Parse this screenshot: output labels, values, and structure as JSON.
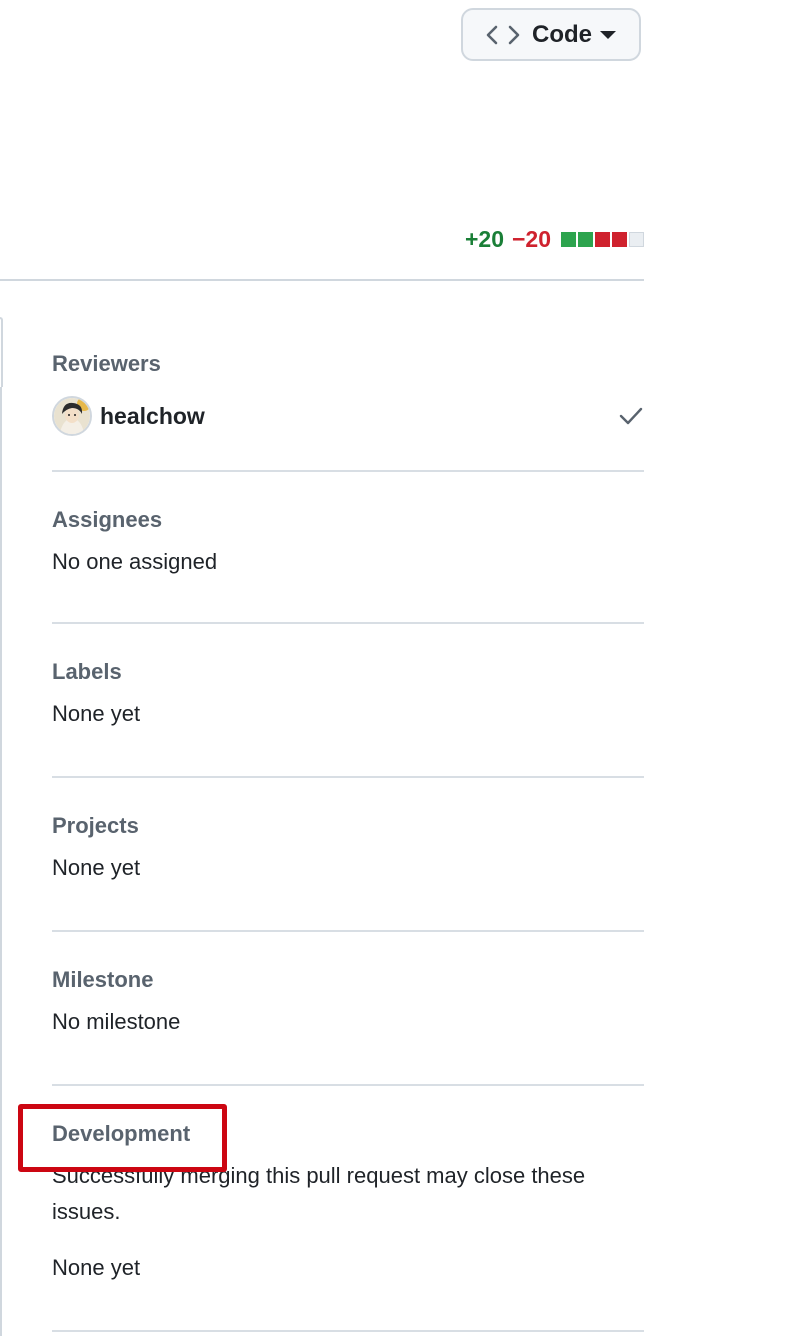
{
  "toolbar": {
    "code_label": "Code",
    "code_icon": "code-icon"
  },
  "diffstat": {
    "additions": "+20",
    "deletions": "−20",
    "blocks": [
      "#2da44e",
      "#2da44e",
      "#cf222e",
      "#cf222e",
      "#eaeef2"
    ]
  },
  "sidebar": {
    "reviewers": {
      "title": "Reviewers",
      "items": [
        {
          "name": "healchow",
          "status_icon": "check-icon"
        }
      ]
    },
    "assignees": {
      "title": "Assignees",
      "value": "No one assigned"
    },
    "labels": {
      "title": "Labels",
      "value": "None yet"
    },
    "projects": {
      "title": "Projects",
      "value": "None yet"
    },
    "milestone": {
      "title": "Milestone",
      "value": "No milestone"
    },
    "development": {
      "title": "Development",
      "description": "Successfully merging this pull request may close these issues.",
      "value": "None yet"
    }
  },
  "colors": {
    "highlight": "#cc0612",
    "addition": "#1a7f37",
    "deletion": "#cf222e"
  }
}
